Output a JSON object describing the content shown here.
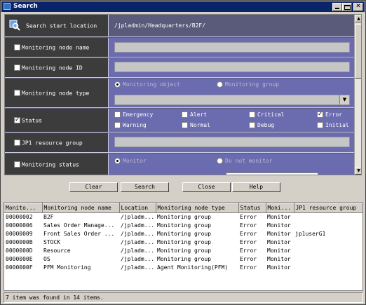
{
  "window": {
    "title": "Search"
  },
  "search": {
    "start_location_label": "Search start location",
    "start_location_value": "/jpladmin/Headquarters/B2F/"
  },
  "form": {
    "node_name": {
      "label": "Monitoring node name",
      "checked": false,
      "value": ""
    },
    "node_id": {
      "label": "Monitoring node ID",
      "checked": false,
      "value": ""
    },
    "node_type": {
      "label": "Monitoring node type",
      "checked": false,
      "radio_object": "Monitoring object",
      "radio_group": "Monitoring group",
      "selected": "Monitoring object"
    },
    "status": {
      "label": "Status",
      "checked": true,
      "options": {
        "emergency": "Emergency",
        "alert": "Alert",
        "critical": "Critical",
        "error": "Error",
        "warning": "Warning",
        "normal": "Normal",
        "debug": "Debug",
        "initial": "Initial"
      },
      "error_checked": true
    },
    "resource_group": {
      "label": "JP1 resource group",
      "checked": false,
      "value": ""
    },
    "monitoring_status": {
      "label": "Monitoring status",
      "checked": false,
      "radio_monitor": "Monitor",
      "radio_no_monitor": "Do not monitor",
      "selected": "Monitor"
    }
  },
  "buttons": {
    "clear": "Clear",
    "search": "Search",
    "close": "Close",
    "help": "Help"
  },
  "results": {
    "columns": [
      "Monito...",
      "Monitoring node name",
      "Location",
      "Monitoring node type",
      "Status",
      "Moni...",
      "JP1 resource group"
    ],
    "rows": [
      [
        "00000002",
        "B2F",
        "/jpladm...",
        "Monitoring group",
        "Error",
        "Monitor",
        ""
      ],
      [
        "00000006",
        "Sales Order Manage...",
        "/jpladm...",
        "Monitoring group",
        "Error",
        "Monitor",
        ""
      ],
      [
        "00000009",
        "Front Sales Order ...",
        "/jpladm...",
        "Monitoring group",
        "Error",
        "Monitor",
        "jp1userG1"
      ],
      [
        "0000000B",
        "STOCK",
        "/jpladm...",
        "Monitoring group",
        "Error",
        "Monitor",
        ""
      ],
      [
        "0000000D",
        "Resource",
        "/jpladm...",
        "Monitoring group",
        "Error",
        "Monitor",
        ""
      ],
      [
        "0000000E",
        "OS",
        "/jpladm...",
        "Monitoring group",
        "Error",
        "Monitor",
        ""
      ],
      [
        "0000000F",
        "PFM Monitoring",
        "/jpladm...",
        "Agent Monitoring(PFM)",
        "Error",
        "Monitor",
        ""
      ]
    ]
  },
  "status_bar": "7 item was found in 14 items."
}
